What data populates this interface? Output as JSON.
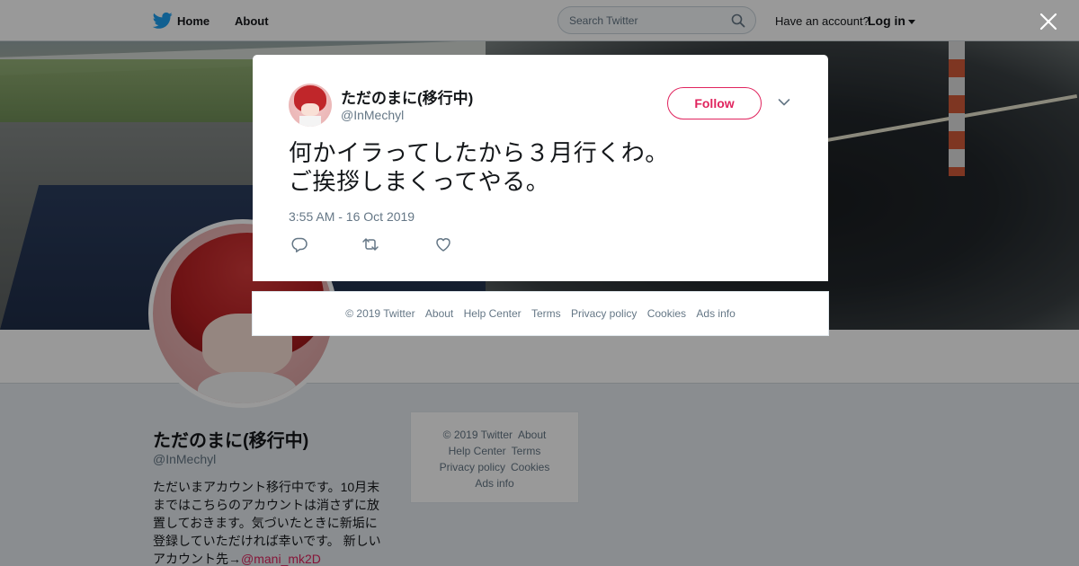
{
  "topbar": {
    "home_label": "Home",
    "about_label": "About",
    "search_placeholder": "Search Twitter",
    "have_account": "Have an account?",
    "login_label": "Log in"
  },
  "profile": {
    "name": "ただのまに(移行中)",
    "handle": "@InMechyl",
    "bio": "ただいまアカウント移行中です。10月末まではこちらのアカウントは消さずに放置しておきます。気づいたときに新垢に登録していただければ幸いです。 新しいアカウント先→",
    "bio_link": "@mani_mk2D"
  },
  "side_footer": {
    "copyright": "© 2019 Twitter",
    "about": "About",
    "help": "Help Center",
    "terms": "Terms",
    "privacy": "Privacy policy",
    "cookies": "Cookies",
    "ads": "Ads info"
  },
  "tweet": {
    "name": "ただのまに(移行中)",
    "handle": "@InMechyl",
    "follow_label": "Follow",
    "text_line1": "何かイラってしたから３月行くわ。",
    "text_line2": "ご挨拶しまくってやる。",
    "timestamp": "3:55 AM - 16 Oct 2019"
  },
  "modal_footer": {
    "copyright": "© 2019 Twitter",
    "about": "About",
    "help": "Help Center",
    "terms": "Terms",
    "privacy": "Privacy policy",
    "cookies": "Cookies",
    "ads": "Ads info"
  },
  "icons": {
    "logo": "twitter-bird-icon",
    "search": "search-icon",
    "close": "close-icon",
    "chevron": "chevron-down-icon",
    "reply": "reply-icon",
    "retweet": "retweet-icon",
    "like": "heart-icon"
  },
  "colors": {
    "brand": "#1da1f2",
    "accent": "#e0245e",
    "text": "#14171a",
    "muted": "#657786"
  }
}
